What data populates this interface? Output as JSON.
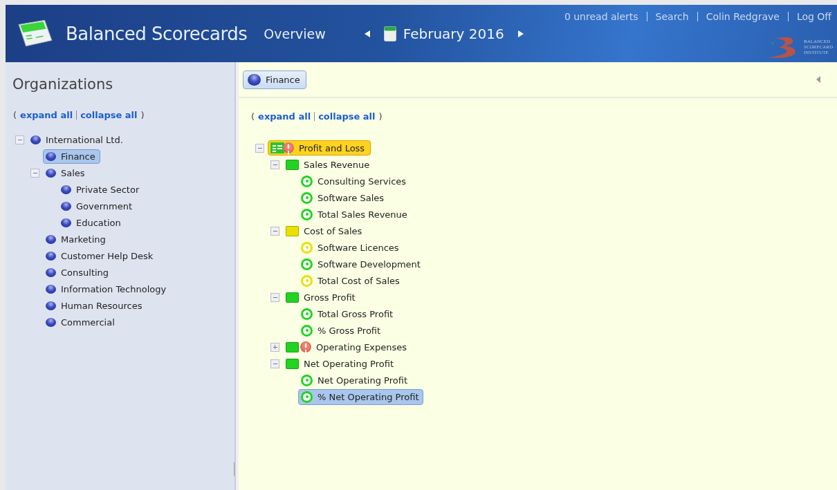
{
  "header": {
    "app_title": "Balanced Scorecards",
    "view_tab": "Overview",
    "period": "February 2016",
    "links": [
      "0 unread alerts",
      "Search",
      "Colin Redgrave",
      "Log Off"
    ],
    "logo_lines": [
      "BALANCED",
      "SCORECARD",
      "INSTITUTE"
    ]
  },
  "sidebar": {
    "title": "Organizations",
    "open_paren": "(",
    "close_paren": ")",
    "expand_all": "expand all",
    "collapse_all": "collapse all",
    "items": [
      {
        "label": "International Ltd.",
        "selected": false,
        "expanded": true,
        "children": [
          {
            "label": "Finance",
            "selected": true
          },
          {
            "label": "Sales",
            "selected": false,
            "expanded": true,
            "children": [
              {
                "label": "Private Sector",
                "selected": false
              },
              {
                "label": "Government",
                "selected": false
              },
              {
                "label": "Education",
                "selected": false
              }
            ]
          },
          {
            "label": "Marketing",
            "selected": false
          },
          {
            "label": "Customer Help Desk",
            "selected": false
          },
          {
            "label": "Consulting",
            "selected": false
          },
          {
            "label": "Information Technology",
            "selected": false
          },
          {
            "label": "Human Resources",
            "selected": false
          },
          {
            "label": "Commercial",
            "selected": false
          }
        ]
      }
    ]
  },
  "main": {
    "breadcrumb": "Finance",
    "open_paren": "(",
    "close_paren": ")",
    "expand_all": "expand all",
    "collapse_all": "collapse all",
    "scorecard": [
      {
        "label": "Profit and Loss",
        "kind": "scorecard",
        "alert": true,
        "selected": true,
        "expanded": true,
        "children": [
          {
            "label": "Sales Revenue",
            "kind": "perspective",
            "color": "#22d322",
            "alert": false,
            "selected": false,
            "expanded": true,
            "children": [
              {
                "label": "Consulting Services",
                "kind": "measure",
                "color": "#22d322",
                "selected": false
              },
              {
                "label": "Software Sales",
                "kind": "measure",
                "color": "#22d322",
                "selected": false
              },
              {
                "label": "Total Sales Revenue",
                "kind": "measure",
                "color": "#22d322",
                "selected": false
              }
            ]
          },
          {
            "label": "Cost of Sales",
            "kind": "perspective",
            "color": "#e8e000",
            "alert": false,
            "selected": false,
            "expanded": true,
            "children": [
              {
                "label": "Software Licences",
                "kind": "measure",
                "color": "#e8e000",
                "selected": false
              },
              {
                "label": "Software Development",
                "kind": "measure",
                "color": "#22d322",
                "selected": false
              },
              {
                "label": "Total Cost of Sales",
                "kind": "measure",
                "color": "#e8e000",
                "selected": false
              }
            ]
          },
          {
            "label": "Gross Profit",
            "kind": "perspective",
            "color": "#22d322",
            "alert": false,
            "selected": false,
            "expanded": true,
            "children": [
              {
                "label": "Total Gross Profit",
                "kind": "measure",
                "color": "#22d322",
                "selected": false
              },
              {
                "label": "% Gross Profit",
                "kind": "measure",
                "color": "#22d322",
                "selected": false
              }
            ]
          },
          {
            "label": "Operating Expenses",
            "kind": "perspective",
            "color": "#22d322",
            "alert": true,
            "selected": false,
            "expanded": false
          },
          {
            "label": "Net Operating Profit",
            "kind": "perspective",
            "color": "#22d322",
            "alert": false,
            "selected": false,
            "expanded": true,
            "children": [
              {
                "label": "Net Operating Profit",
                "kind": "measure",
                "color": "#22d322",
                "selected": false
              },
              {
                "label": "% Net Operating Profit",
                "kind": "measure",
                "color": "#22d322",
                "selected": true
              }
            ]
          }
        ]
      }
    ]
  }
}
